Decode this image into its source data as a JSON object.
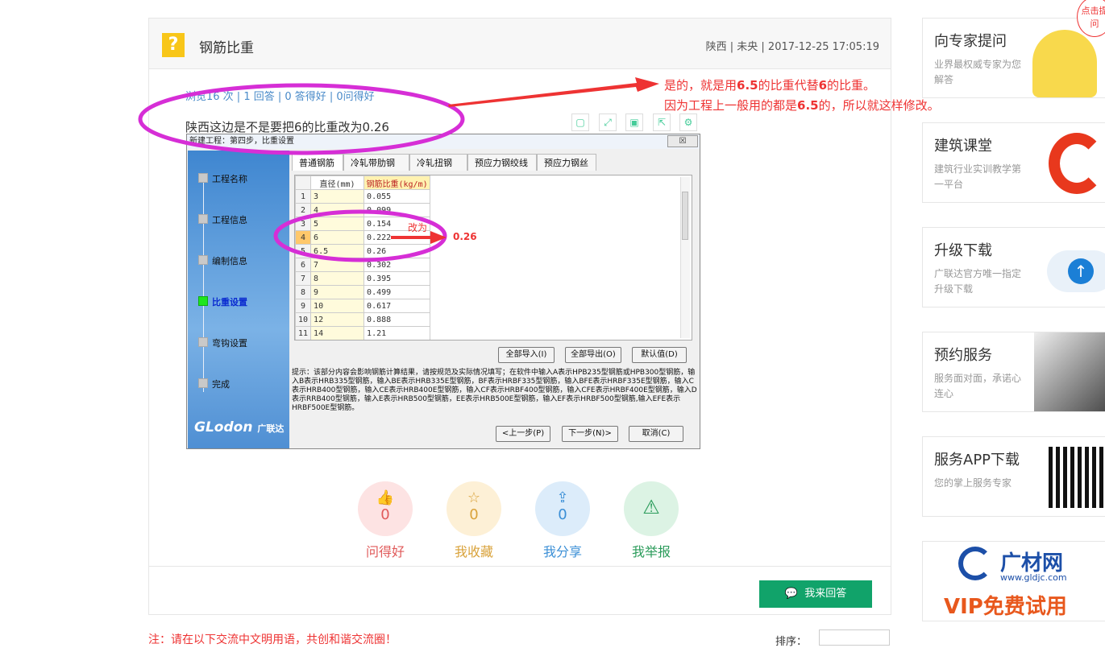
{
  "question": {
    "title": "钢筋比重",
    "meta": "陕西 | 未央 | 2017-12-25 17:05:19",
    "stats": "浏览16 次 | 1 回答 | 0 答得好 | 0问得好",
    "text": "陕西这边是不是要把6的比重改为0.26"
  },
  "annotation": {
    "line1_a": "是的，就是用",
    "line1_b": "6.5",
    "line1_c": "的比重代替",
    "line1_d": "6",
    "line1_e": "的比重。",
    "line2_a": "因为工程上一般用的都是",
    "line2_b": "6.5",
    "line2_c": "的，所以就这样修改。",
    "change_label": "改为",
    "change_value": "0.26"
  },
  "dialog": {
    "title": "新建工程：第四步，比重设置",
    "close": "☒",
    "steps": [
      "工程名称",
      "工程信息",
      "编制信息",
      "比重设置",
      "弯钩设置",
      "完成"
    ],
    "logo": "GLodon",
    "logo_cn": "广联达",
    "tabs": [
      "普通钢筋",
      "冷轧带肋钢筋",
      "冷轧扭钢筋",
      "预应力钢绞线",
      "预应力钢丝"
    ],
    "col_diameter": "直径(mm)",
    "col_weight": "钢筋比重(kg/m)",
    "rows": [
      [
        "1",
        "3",
        "0.055"
      ],
      [
        "2",
        "4",
        "0.099"
      ],
      [
        "3",
        "5",
        "0.154"
      ],
      [
        "4",
        "6",
        "0.222"
      ],
      [
        "5",
        "6.5",
        "0.26"
      ],
      [
        "6",
        "7",
        "0.302"
      ],
      [
        "7",
        "8",
        "0.395"
      ],
      [
        "8",
        "9",
        "0.499"
      ],
      [
        "9",
        "10",
        "0.617"
      ],
      [
        "10",
        "12",
        "0.888"
      ],
      [
        "11",
        "14",
        "1.21"
      ]
    ],
    "btn_import": "全部导入(I)",
    "btn_export": "全部导出(O)",
    "btn_default": "默认值(D)",
    "hint": "提示：该部分内容会影响钢筋计算结果，请按规范及实际情况填写；在软件中输入A表示HPB235型钢筋或HPB300型钢筋，输入B表示HRB335型钢筋，输入BE表示HRB335E型钢筋，BF表示HRBF335型钢筋，输入BFE表示HRBF335E型钢筋，输入C表示HRB400型钢筋，输入CE表示HRB400E型钢筋，输入CF表示HRBF400型钢筋，输入CFE表示HRBF400E型钢筋，输入D表示RRB400型钢筋，输入E表示HRB500型钢筋，EE表示HRB500E型钢筋，输入EF表示HRBF500型钢筋,输入EFE表示HRBF500E型钢筋。",
    "btn_prev": "<上一步(P)",
    "btn_next": "下一步(N)>",
    "btn_cancel": "取消(C)"
  },
  "actions": [
    {
      "label": "问得好",
      "count": "0",
      "icon": "thumbs-up-icon",
      "color": "#e05a5a",
      "bg": "#fde3e3"
    },
    {
      "label": "我收藏",
      "count": "0",
      "icon": "star-icon",
      "color": "#d9a23a",
      "bg": "#fdf0d6"
    },
    {
      "label": "我分享",
      "count": "0",
      "icon": "share-icon",
      "color": "#3b8fd6",
      "bg": "#dcecfa"
    },
    {
      "label": "我举报",
      "count": "",
      "icon": "warning-icon",
      "color": "#2a9b5a",
      "bg": "#dcf3e4"
    }
  ],
  "answer_button": "我来回答",
  "footer_note": "注：请在以下交流中文明用语，共创和谐交流圈！",
  "sort_label": "排序：",
  "sidebar": [
    {
      "title": "向专家提问",
      "sub": "业界最权威专家为您解答"
    },
    {
      "title": "建筑课堂",
      "sub": "建筑行业实训教学第一平台"
    },
    {
      "title": "升级下载",
      "sub": "广联达官方唯一指定升级下载"
    },
    {
      "title": "预约服务",
      "sub": "服务面对面，承诺心连心"
    },
    {
      "title": "服务APP下载",
      "sub": "您的掌上服务专家"
    }
  ],
  "promo": {
    "brand": "广材网",
    "url": "www.gldjc.com",
    "vip": "VIP免费试用"
  },
  "bubble": "点击提问",
  "colors": {
    "accent_red": "#e33",
    "magenta": "#d62ed6",
    "green": "#11a36a"
  }
}
